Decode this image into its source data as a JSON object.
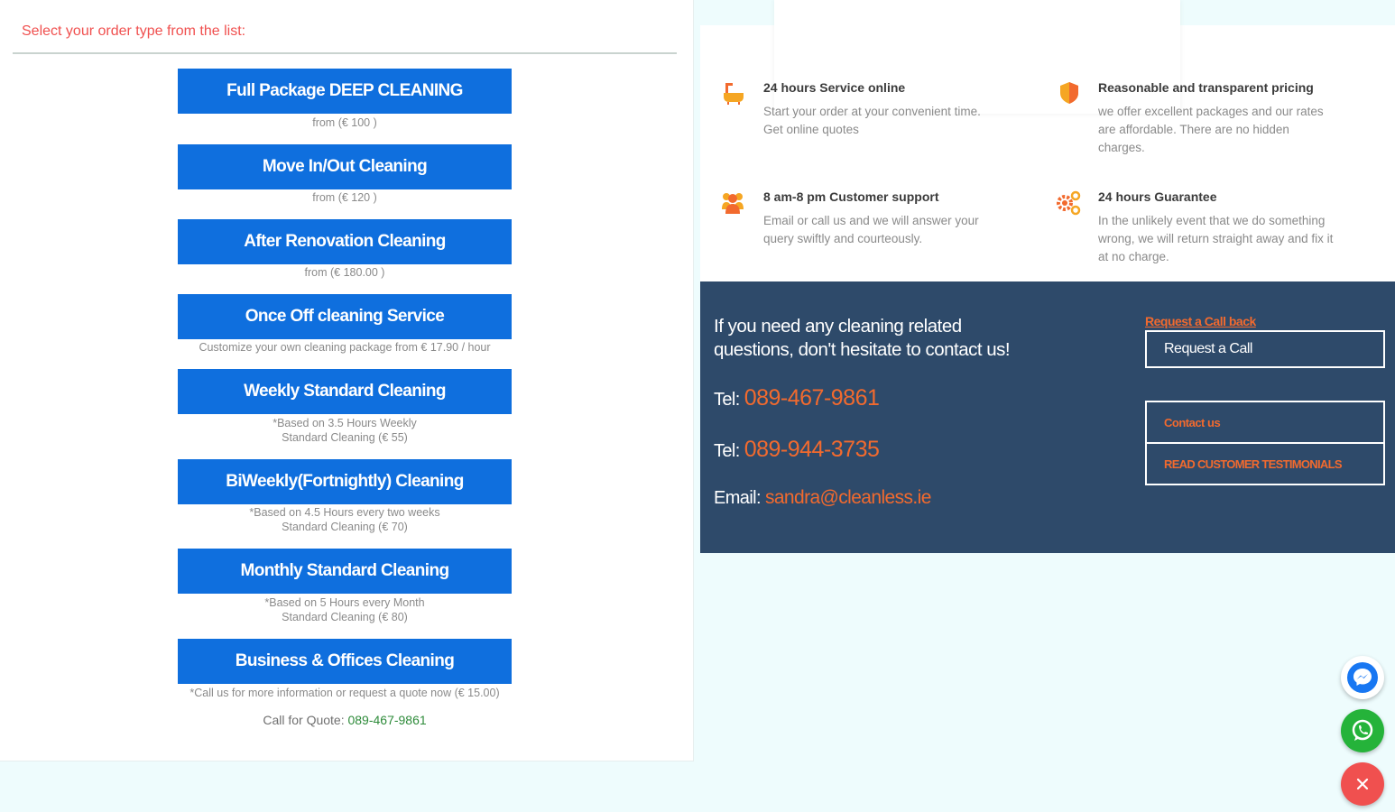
{
  "orders": {
    "heading": "Select your order type from the list:",
    "items": [
      {
        "label": "Full Package DEEP CLEANING",
        "note": "from (€ 100 )"
      },
      {
        "label": "Move In/Out Cleaning",
        "note": "from (€ 120 )"
      },
      {
        "label": "After Renovation Cleaning",
        "note": "from (€ 180.00 )"
      },
      {
        "label": "Once Off cleaning Service",
        "note": "Customize your own cleaning package from € 17.90 / hour"
      },
      {
        "label": "Weekly Standard Cleaning",
        "note": "*Based on 3.5 Hours Weekly",
        "note2": "Standard Cleaning (€ 55)"
      },
      {
        "label": "BiWeekly(Fortnightly) Cleaning",
        "note": "*Based on 4.5 Hours every two weeks",
        "note2": "Standard Cleaning (€ 70)"
      },
      {
        "label": "Monthly Standard Cleaning",
        "note": "*Based on 5 Hours every Month",
        "note2": "Standard Cleaning (€ 80)"
      },
      {
        "label": "Business & Offices Cleaning",
        "note": "*Call us for more information or request a quote now (€ 15.00)"
      }
    ],
    "quote_label": "Call for Quote:",
    "quote_phone": "089-467-9861"
  },
  "features": [
    {
      "icon": "bathtub-icon",
      "title": "24 hours Service online",
      "text1": "Start your order at your convenient time.",
      "text2": "Get online quotes",
      "text3": ""
    },
    {
      "icon": "shield-icon",
      "title": "Reasonable and transparent pricing",
      "text1": "we offer excellent packages and our rates",
      "text2": "are affordable. There are no hidden",
      "text3": "charges."
    },
    {
      "icon": "team-icon",
      "title": "8 am-8 pm Customer support",
      "text1": "Email or call us and we will answer your",
      "text2": "query swiftly and courteously.",
      "text3": ""
    },
    {
      "icon": "gears-icon",
      "title": "24 hours Guarantee",
      "text1": "In the unlikely event that we do something",
      "text2": "wrong, we will return straight away and fix it",
      "text3": "at no charge."
    }
  ],
  "contact": {
    "headline1": "If you need any cleaning related",
    "headline2": "questions, don't hesitate to contact us!",
    "tel_label": "Tel:",
    "tel1": "089-467-9861",
    "tel2": "089-944-3735",
    "email_label": "Email:",
    "email": "sandra@cleanless.ie",
    "callback_link": "Request a Call back",
    "callback_button": "Request a Call",
    "contact_us": "Contact us",
    "testimonials": "READ CUSTOMER TESTIMONIALS"
  },
  "colors": {
    "accent_blue": "#0f6fde",
    "accent_orange": "#f26a2e",
    "heading_red": "#f0504f",
    "contact_bg": "#2e4a6a",
    "page_bg": "#eefcfd"
  },
  "floating": [
    {
      "icon": "messenger-icon",
      "color": "#1877f2"
    },
    {
      "icon": "whatsapp-icon",
      "color": "#25b33a"
    },
    {
      "icon": "close-icon",
      "color": "#f0504f"
    }
  ]
}
